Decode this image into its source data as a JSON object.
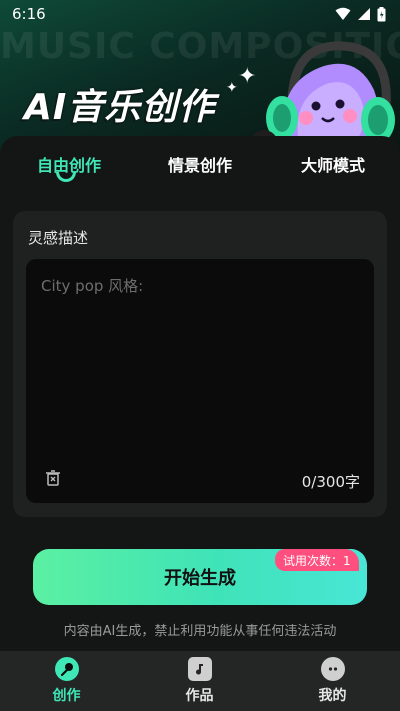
{
  "status_bar": {
    "time": "6:16"
  },
  "hero": {
    "watermark": "MUSIC COMPOSITION",
    "title": "AI音乐创作"
  },
  "tabs": [
    {
      "label": "自由创作",
      "active": true
    },
    {
      "label": "情景创作",
      "active": false
    },
    {
      "label": "大师模式",
      "active": false
    }
  ],
  "inspiration": {
    "label": "灵感描述",
    "placeholder": "City pop 风格:",
    "counter": "0/300字"
  },
  "generate": {
    "button_label": "开始生成",
    "trial_badge": "试用次数：1"
  },
  "disclaimer": "内容由AI生成，禁止利用功能从事任何违法活动",
  "bottom_nav": [
    {
      "label": "创作",
      "icon": "mic-icon",
      "active": true
    },
    {
      "label": "作品",
      "icon": "music-note-icon",
      "active": false
    },
    {
      "label": "我的",
      "icon": "profile-face-icon",
      "active": false
    }
  ],
  "colors": {
    "accent": "#3ee7b5",
    "badge": "#ff4f7e",
    "button_gradient_start": "#5bf0a2",
    "button_gradient_end": "#48e6d6"
  }
}
